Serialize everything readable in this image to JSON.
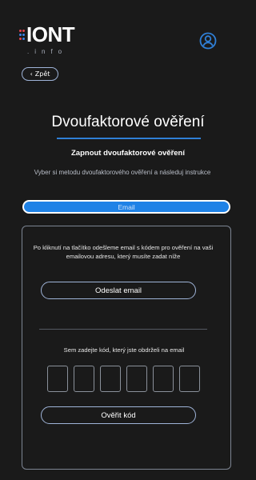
{
  "header": {
    "logo_main": "IONT",
    "logo_sub": ".info",
    "back_label": "Zpět",
    "user_icon": "user-circle-icon",
    "accent_color": "#2f7fd6",
    "logo_dot_colors": [
      "#e2444f",
      "#3b82e8"
    ]
  },
  "page": {
    "title": "Dvoufaktorové ověření",
    "subtitle": "Zapnout dvoufaktorové ověření",
    "instruction": "Vyber si metodu dvoufaktorového ověření a následuj instrukce"
  },
  "methods": {
    "selected": "Email"
  },
  "email_card": {
    "description": "Po kliknutí na tlačítko odešleme email s kódem pro ověření na vaši emailovou adresu, který musíte zadat níže",
    "send_label": "Odeslat email",
    "code_label": "Sem zadejte kód, který jste obdrželi na email",
    "code_length": 6,
    "verify_label": "Ověřit kód"
  }
}
